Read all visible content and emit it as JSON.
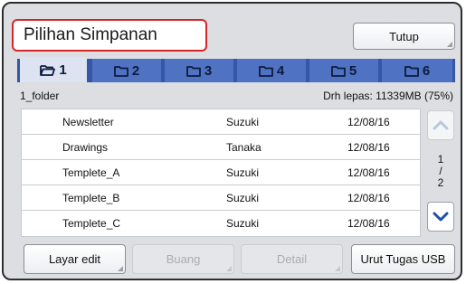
{
  "dialog": {
    "title": "Pilihan Simpanan",
    "close_label": "Tutup"
  },
  "tabs": [
    {
      "label": "1",
      "active": true
    },
    {
      "label": "2",
      "active": false
    },
    {
      "label": "3",
      "active": false
    },
    {
      "label": "4",
      "active": false
    },
    {
      "label": "5",
      "active": false
    },
    {
      "label": "6",
      "active": false
    }
  ],
  "folder": {
    "name": "1_folder",
    "free_space": "Drh lepas: 11339MB (75%)"
  },
  "files": [
    {
      "name": "Newsletter",
      "owner": "Suzuki",
      "date": "12/08/16"
    },
    {
      "name": "Drawings",
      "owner": "Tanaka",
      "date": "12/08/16"
    },
    {
      "name": "Templete_A",
      "owner": "Suzuki",
      "date": "12/08/16"
    },
    {
      "name": "Templete_B",
      "owner": "Suzuki",
      "date": "12/08/16"
    },
    {
      "name": "Templete_C",
      "owner": "Suzuki",
      "date": "12/08/16"
    }
  ],
  "pager": {
    "current": "1",
    "separator": "/",
    "total": "2"
  },
  "actions": {
    "edit_label": "Layar edit",
    "delete_label": "Buang",
    "detail_label": "Detail",
    "usb_label": "Urut Tugas USB"
  },
  "colors": {
    "title_border": "#d7262b",
    "tab_bar": "#3358a6",
    "tab": "#4f72c2",
    "active_tab": "#dde3f0",
    "scroll_arrow": "#1f4fa8",
    "disabled_arrow": "#b9c6dc"
  },
  "icons": {
    "tab_icon": "folder-icon",
    "active_tab_icon": "open-folder-icon",
    "scroll_up": "chevron-up-icon",
    "scroll_down": "chevron-down-icon"
  }
}
